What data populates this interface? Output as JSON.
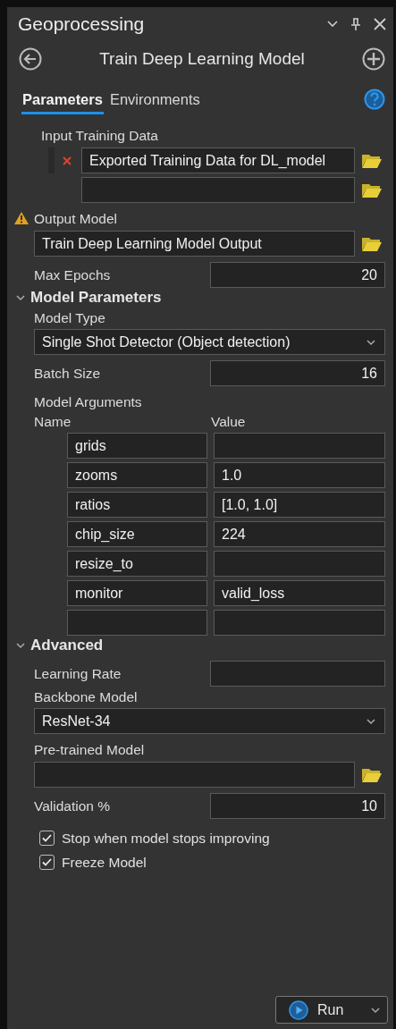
{
  "panel": {
    "title": "Geoprocessing"
  },
  "tool": {
    "title": "Train Deep Learning Model"
  },
  "tabs": [
    {
      "label": "Parameters",
      "selected": true
    },
    {
      "label": "Environments",
      "selected": false
    }
  ],
  "parameters": [
    {
      "kind": "multi_path",
      "label": "Input Training Data",
      "warning": false,
      "rows": [
        {
          "value": "Exported Training Data for DL_model",
          "removable": true
        },
        {
          "removable": false
        }
      ]
    },
    {
      "kind": "path",
      "label": "Output Model",
      "warning": true,
      "value": "Train Deep Learning Model Output"
    },
    {
      "kind": "number",
      "label": "Max Epochs",
      "value": "20"
    }
  ],
  "groups": [
    {
      "title": "Model Parameters",
      "expanded": true,
      "parameters": [
        {
          "kind": "dropdown",
          "label": "Model Type",
          "value": "Single Shot Detector (Object detection)"
        },
        {
          "kind": "number",
          "label": "Batch Size",
          "value": "16"
        },
        {
          "kind": "table",
          "label": "Model Arguments",
          "columns": [
            "Name",
            "Value"
          ],
          "rows": [
            {
              "kind": "pair",
              "name": "grids"
            },
            {
              "kind": "pair",
              "name": "zooms",
              "value": "1.0"
            },
            {
              "kind": "pair",
              "name": "ratios",
              "value": "[1.0, 1.0]"
            },
            {
              "kind": "pair",
              "name": "chip_size",
              "value": "224"
            },
            {
              "kind": "pair",
              "name": "resize_to"
            },
            {
              "kind": "pair",
              "name": "monitor",
              "value": "valid_loss"
            },
            {
              "kind": "new_row"
            }
          ]
        }
      ]
    },
    {
      "title": "Advanced",
      "expanded": true,
      "parameters": [
        {
          "kind": "number",
          "label": "Learning Rate"
        },
        {
          "kind": "dropdown",
          "label": "Backbone Model",
          "value": "ResNet-34"
        },
        {
          "kind": "path",
          "label": "Pre-trained Model",
          "warning": false
        },
        {
          "kind": "number",
          "label": "Validation %",
          "value": "10"
        },
        {
          "kind": "checkbox",
          "label": "Stop when model stops improving",
          "checked": true
        },
        {
          "kind": "checkbox",
          "label": "Freeze Model",
          "checked": true
        }
      ]
    }
  ],
  "run_button": {
    "label": "Run"
  }
}
